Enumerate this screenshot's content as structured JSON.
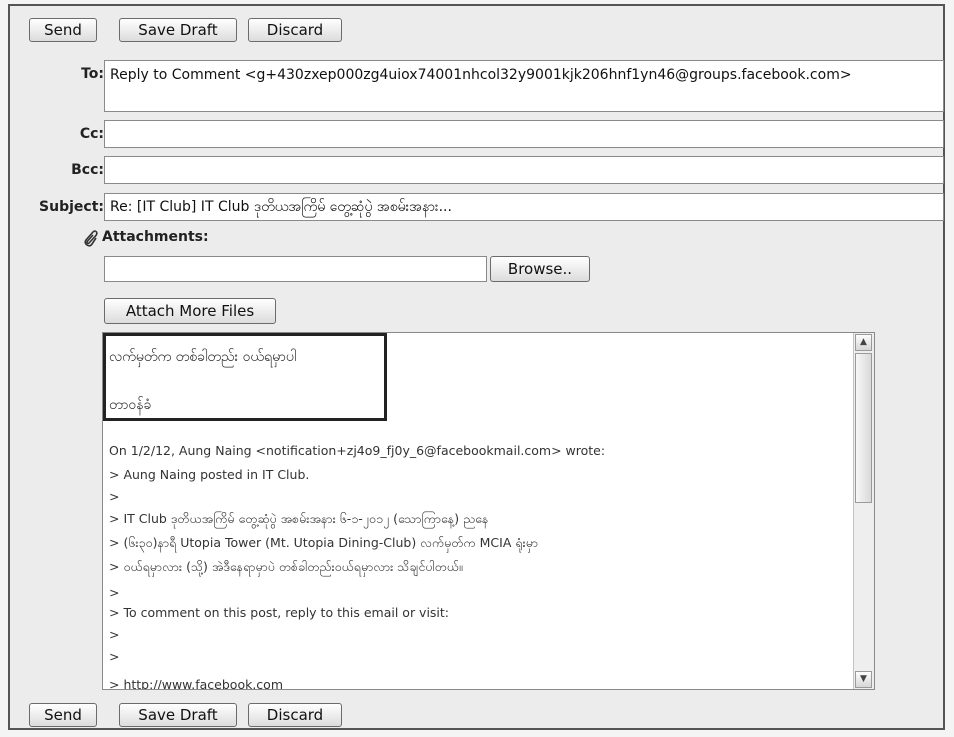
{
  "toolbar_top": {
    "send": "Send",
    "save_draft": "Save Draft",
    "discard": "Discard"
  },
  "toolbar_bottom": {
    "send": "Send",
    "save_draft": "Save Draft",
    "discard": "Discard"
  },
  "labels": {
    "to": "To:",
    "cc": "Cc:",
    "bcc": "Bcc:",
    "subject": "Subject:",
    "attachments": "Attachments:"
  },
  "fields": {
    "to": "Reply to Comment <g+430zxep000zg4uiox74001nhcol32y9001kjk206hnf1yn46@groups.facebook.com>",
    "cc": "",
    "bcc": "",
    "subject": "Re: [IT Club] IT Club ဒုတိယအကြိမ် တွေ့ဆုံပွဲ အစမ်းအနား..."
  },
  "attachments": {
    "browse": "Browse..",
    "attach_more": "Attach More Files"
  },
  "body": {
    "reply_lines": [
      "လက်မှတ်က တစ်ခါတည်း ဝယ်ရမှာပါ",
      "",
      "တာဝန်ခံ"
    ],
    "quote_header": "On 1/2/12, Aung Naing <notification+zj4o9_fj0y_6@facebookmail.com> wrote:",
    "quoted_lines": [
      "> Aung Naing posted in IT Club.",
      ">",
      "> IT Club ဒုတိယအကြိမ် တွေ့ဆုံပွဲ အစမ်းအနား ၆-၁-၂၀၁၂ (သောကြာနေ့) ညနေ",
      "> (၆း၃၀)နာရီ Utopia Tower (Mt. Utopia Dining-Club) လက်မှတ်က MCIA ရုံးမှာ",
      "> ဝယ်ရမှာလား (သို့) အဲဒီနေရာမှာပဲ တစ်ခါတည်းဝယ်ရမှာလား သိချင်ပါတယ်။",
      ">",
      "> To comment on this post, reply to this email or visit:",
      ">",
      ">",
      "> http://www.facebook.com"
    ]
  },
  "scroll_up_icon": "chevron-up-icon",
  "scroll_down_icon": "chevron-down-icon",
  "attachment_icon": "paperclip-icon"
}
